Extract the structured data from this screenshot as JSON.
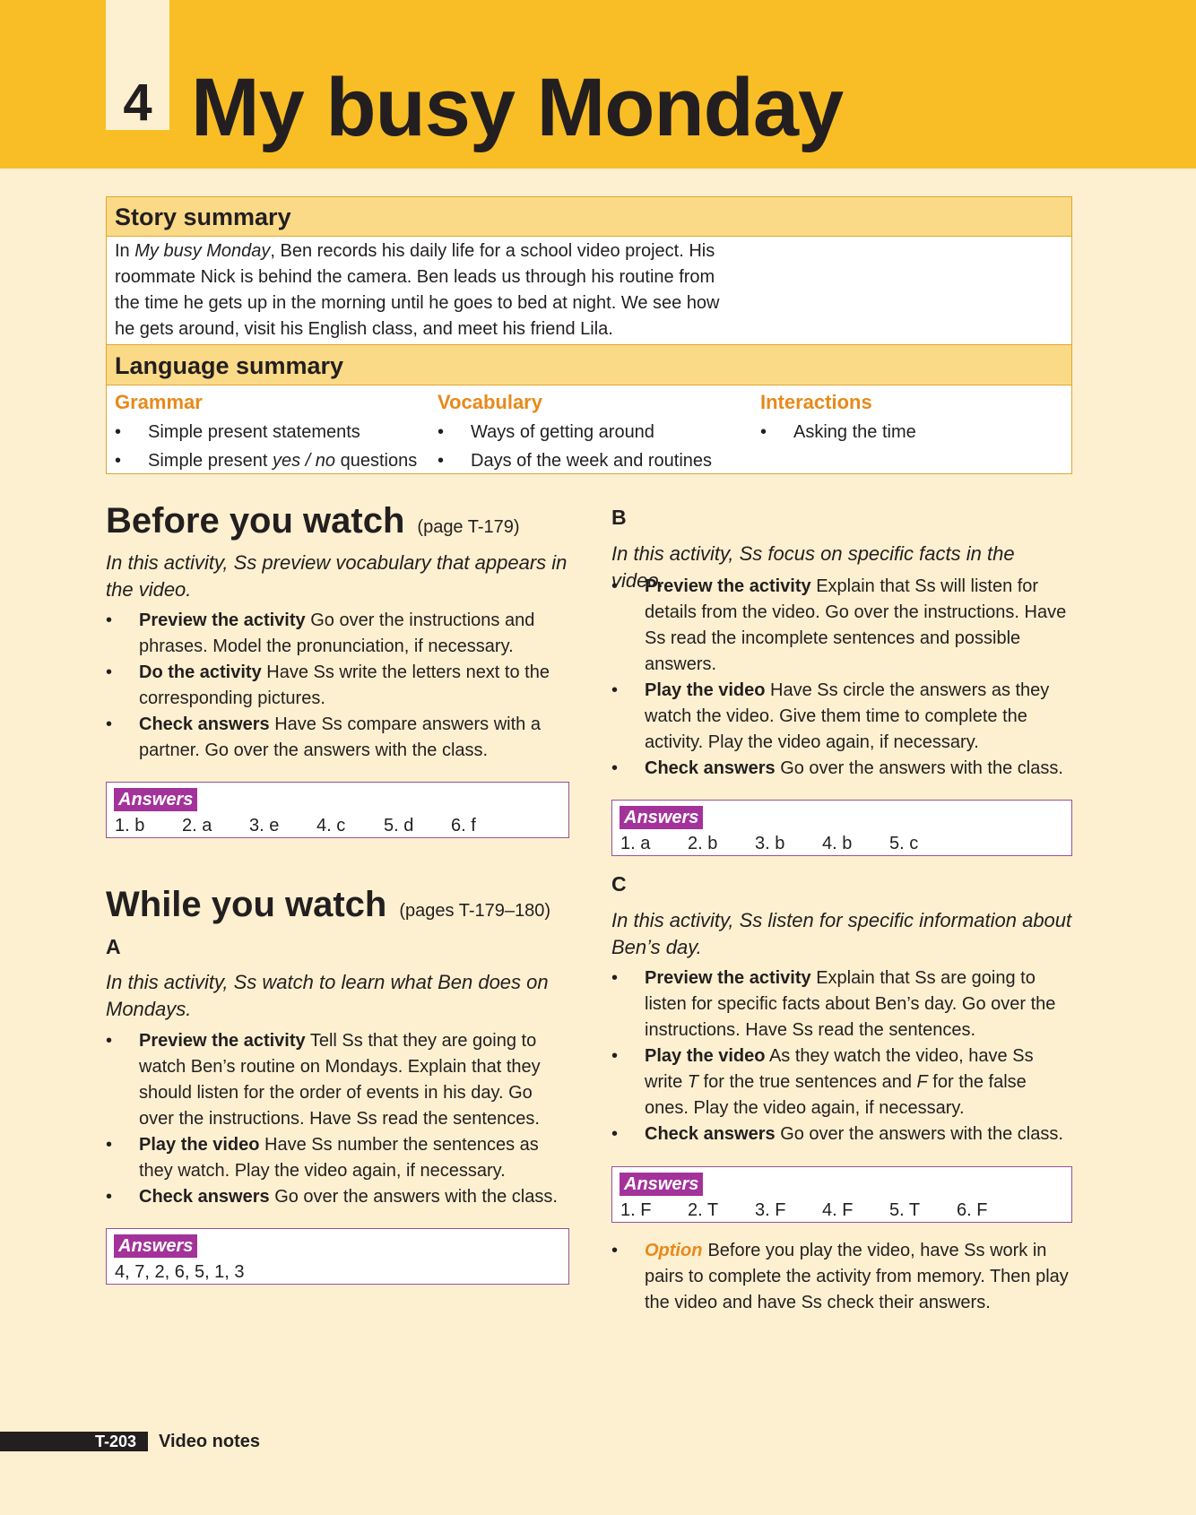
{
  "header": {
    "unit_number": "4",
    "title": "My busy Monday"
  },
  "story_summary": {
    "heading": "Story summary",
    "text_pre": "In ",
    "text_title": "My busy Monday",
    "text_post": ", Ben records his daily life for a school video project. His roommate Nick is behind the camera. Ben leads us through his routine from the time he gets up in the morning until he goes to bed at night. We see how he gets around, visit his English class, and meet his friend Lila."
  },
  "language_summary": {
    "heading": "Language summary",
    "grammar": {
      "title": "Grammar",
      "item1": "Simple present statements",
      "item2_pre": "Simple present ",
      "item2_em": "yes / no",
      "item2_post": " questions"
    },
    "vocabulary": {
      "title": "Vocabulary",
      "items": [
        "Ways of getting around",
        "Days of the week and routines"
      ]
    },
    "interactions": {
      "title": "Interactions",
      "items": [
        "Asking the time"
      ]
    }
  },
  "before_watch": {
    "title": "Before you watch",
    "page_ref": "(page T-179)",
    "intro": "In this activity, Ss preview vocabulary that appears in the video.",
    "bullets": [
      {
        "bold": "Preview the activity",
        "text": " Go over the instructions and phrases. Model the pronunciation, if necessary."
      },
      {
        "bold": "Do the activity",
        "text": " Have Ss write the letters next to the corresponding pictures."
      },
      {
        "bold": "Check answers",
        "text": " Have Ss compare answers with a partner. Go over the answers with the class."
      }
    ],
    "answers_label": "Answers",
    "answers": [
      "1. b",
      "2. a",
      "3. e",
      "4. c",
      "5. d",
      "6. f"
    ]
  },
  "while_watch": {
    "title": "While you watch",
    "page_ref": "(pages T-179–180)",
    "A": {
      "letter": "A",
      "intro": "In this activity, Ss watch to learn what Ben does on Mondays.",
      "bullets": [
        {
          "bold": "Preview the activity",
          "text": " Tell Ss that they are going to watch Ben’s routine on Mondays. Explain that they should listen for the order of events in his day. Go over the instructions. Have Ss read the sentences."
        },
        {
          "bold": "Play the video",
          "text": " Have Ss number the sentences as they watch. Play the video again, if necessary."
        },
        {
          "bold": "Check answers",
          "text": " Go over the answers with the class."
        }
      ],
      "answers_label": "Answers",
      "answers_text": "4, 7, 2, 6, 5, 1, 3"
    },
    "B": {
      "letter": "B",
      "intro": "In this activity, Ss focus on specific facts in the video.",
      "bullets": [
        {
          "bold": "Preview the activity",
          "text": " Explain that Ss will listen for details from the video. Go over the instructions. Have Ss read the incomplete sentences and possible answers."
        },
        {
          "bold": "Play the video",
          "text": " Have Ss circle the answers as they watch the video. Give them time to complete the activity. Play the video again, if necessary."
        },
        {
          "bold": "Check answers",
          "text": " Go over the answers with the class."
        }
      ],
      "answers_label": "Answers",
      "answers": [
        "1. a",
        "2. b",
        "3. b",
        "4. b",
        "5. c"
      ]
    },
    "C": {
      "letter": "C",
      "intro": "In this activity, Ss listen for specific information about Ben’s day.",
      "b1_bold": "Preview the activity",
      "b1_text": " Explain that Ss are going to listen for specific facts about Ben’s day. Go over the instructions. Have Ss read the sentences.",
      "b2_bold": "Play the video",
      "b2_text1": " As they watch the video, have Ss write ",
      "b2_t": "T",
      "b2_text2": " for the true sentences and ",
      "b2_f": "F",
      "b2_text3": " for the false ones. Play the video again, if necessary.",
      "b3_bold": "Check answers",
      "b3_text": " Go over the answers with the class.",
      "answers_label": "Answers",
      "answers": [
        "1. F",
        "2. T",
        "3. F",
        "4. F",
        "5. T",
        "6. F"
      ],
      "option_label": "Option",
      "option_text": "Before you play the video, have Ss work in pairs to complete the activity from memory. Then play the video and have Ss check their answers."
    }
  },
  "footer": {
    "page": "T-203",
    "label": "Video notes"
  }
}
